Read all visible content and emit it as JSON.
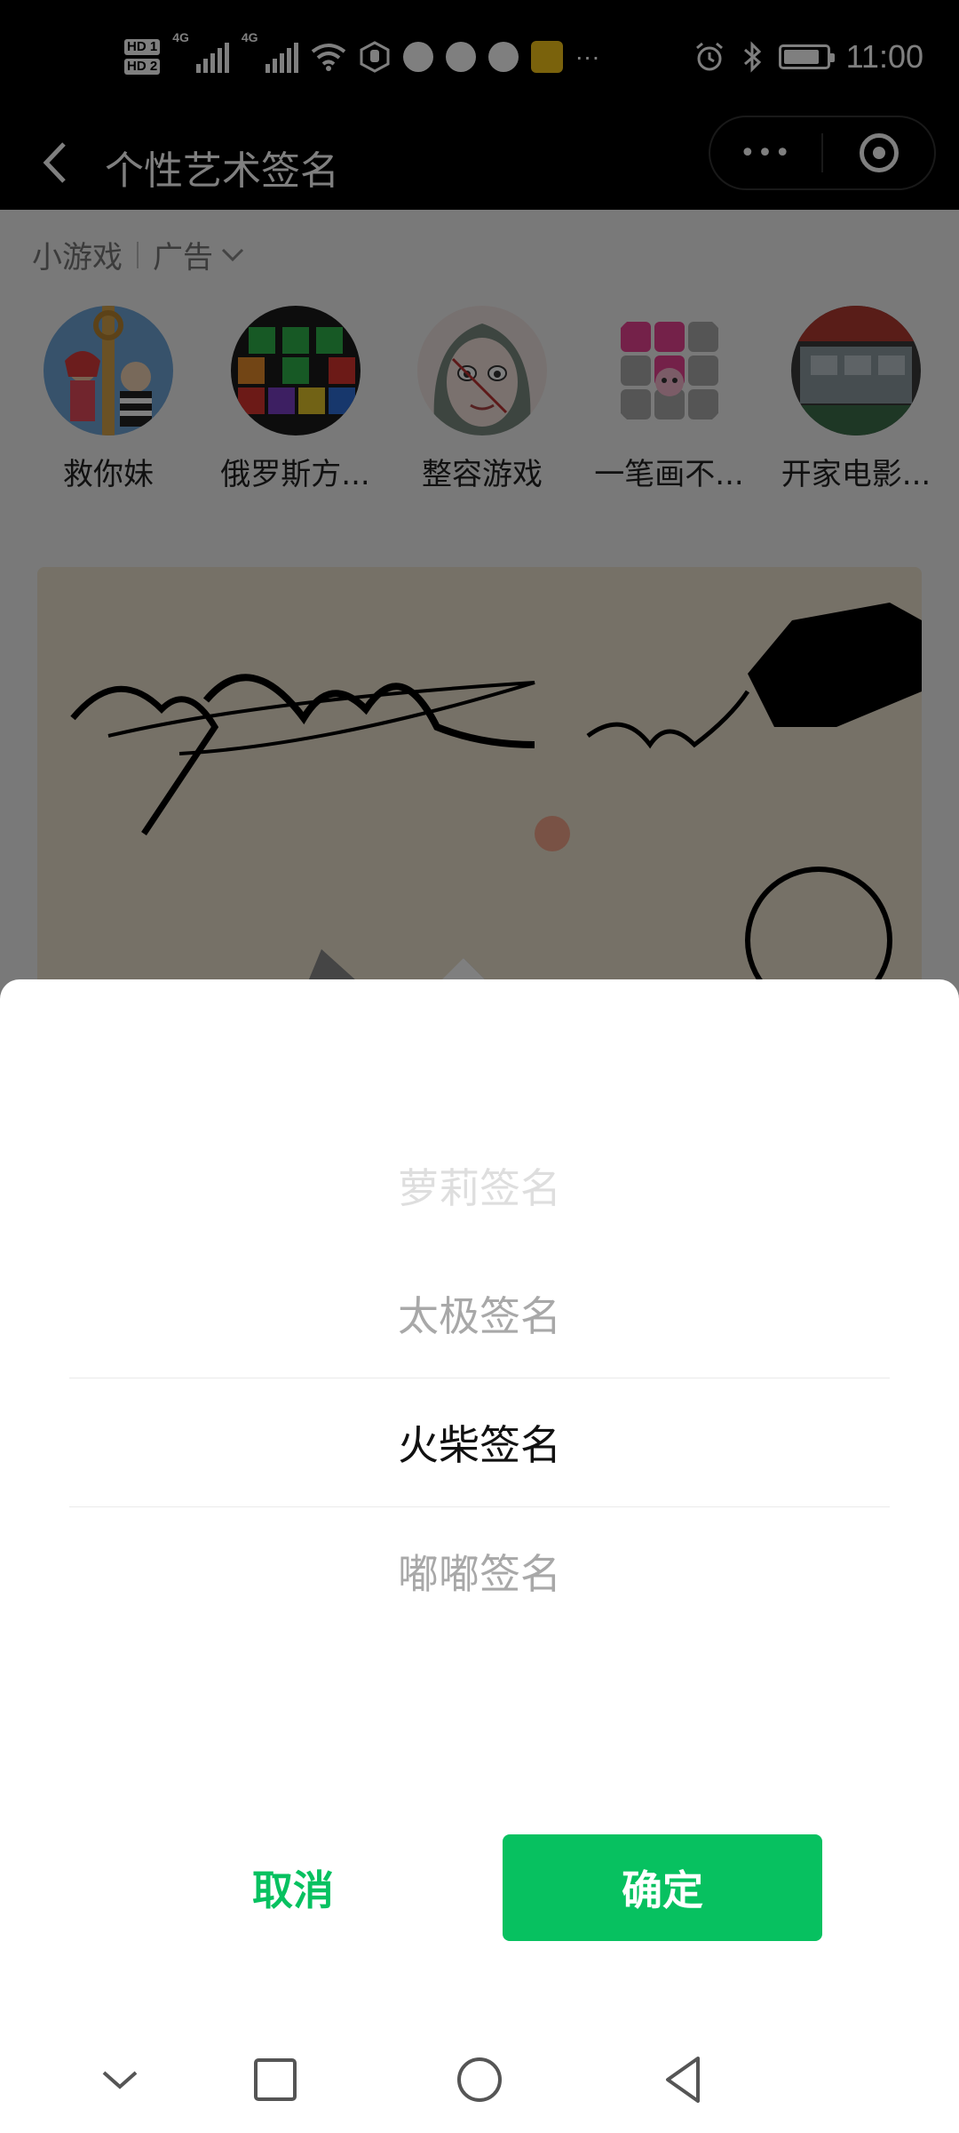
{
  "status_bar": {
    "sim1": "HD",
    "sim2": "HD",
    "sim1_num": "1",
    "sim2_num": "2",
    "net1": "4G",
    "net2": "4G",
    "more": "···",
    "time": "11:00",
    "battery_level": 0.85
  },
  "nav": {
    "title": "个性艺术签名"
  },
  "ad": {
    "games_label": "小游戏",
    "ad_label": "广告"
  },
  "games": [
    {
      "label": "救你妹"
    },
    {
      "label": "俄罗斯方..."
    },
    {
      "label": "整容游戏"
    },
    {
      "label": "一笔画不..."
    },
    {
      "label": "开家电影..."
    }
  ],
  "picker": {
    "options": [
      "萝莉签名",
      "太极签名",
      "火柴签名",
      "嘟嘟签名"
    ],
    "selected_index": 2
  },
  "buttons": {
    "cancel": "取消",
    "confirm": "确定"
  },
  "colors": {
    "accent": "#07c160"
  }
}
